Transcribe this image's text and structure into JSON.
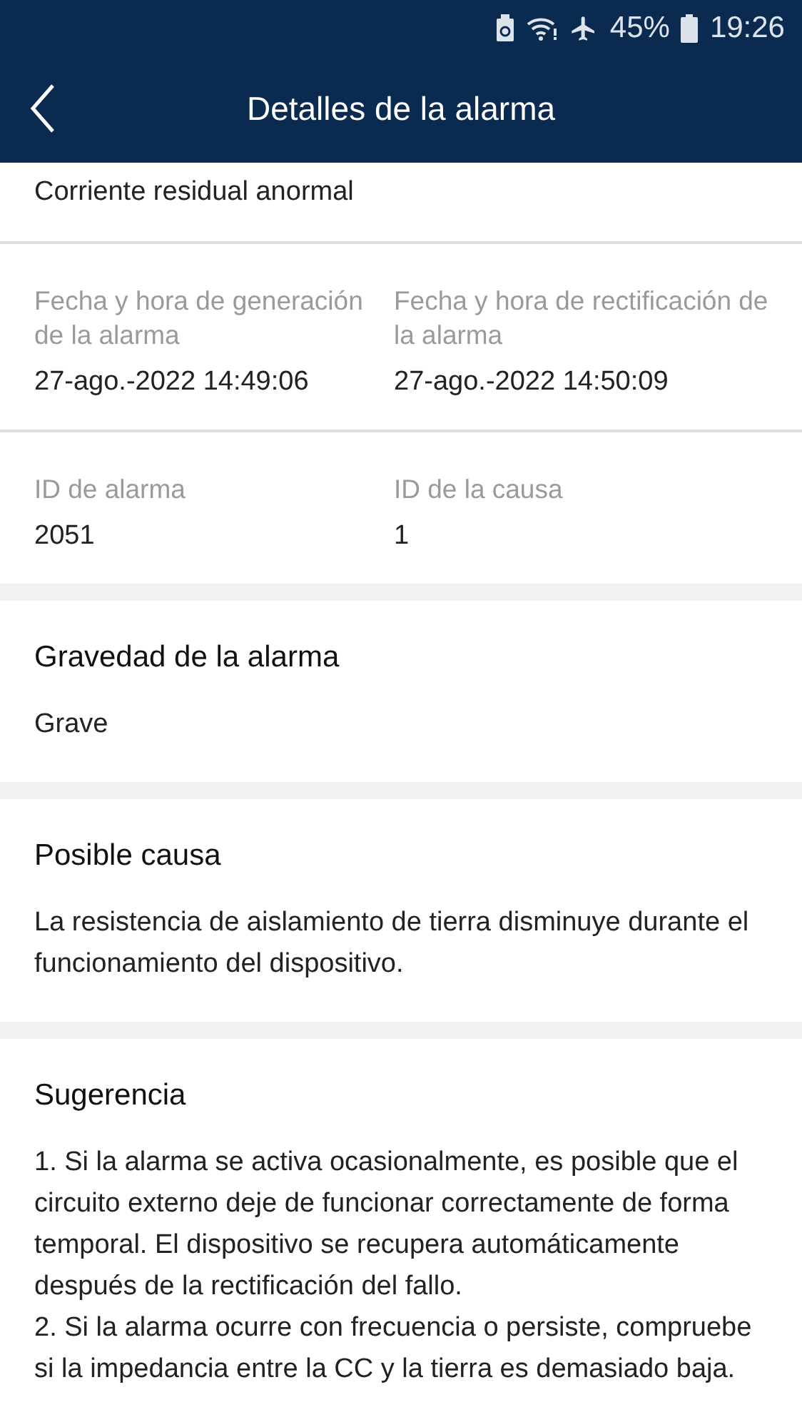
{
  "status_bar": {
    "battery_percent": "45%",
    "time": "19:26"
  },
  "header": {
    "title": "Detalles de la alarma"
  },
  "alarm_name": "Corriente residual anormal",
  "field_rows": [
    {
      "fields": [
        {
          "label": "Fecha y hora de generación de la alarma",
          "value": "27-ago.-2022 14:49:06"
        },
        {
          "label": "Fecha y hora de rectificación de la alarma",
          "value": "27-ago.-2022 14:50:09"
        }
      ]
    },
    {
      "fields": [
        {
          "label": "ID de alarma",
          "value": "2051"
        },
        {
          "label": "ID de la causa",
          "value": "1"
        }
      ]
    }
  ],
  "sections": [
    {
      "title": "Gravedad de la alarma",
      "paragraphs": [
        "Grave"
      ]
    },
    {
      "title": "Posible causa",
      "paragraphs": [
        "La resistencia de aislamiento de tierra disminuye durante el funcionamiento del dispositivo."
      ]
    },
    {
      "title": "Sugerencia",
      "paragraphs": [
        "1. Si la alarma se activa ocasionalmente, es posible que el circuito externo deje de funcionar correctamente de forma temporal. El dispositivo se recupera automáticamente después de la rectificación del fallo.",
        "2. Si la alarma ocurre con frecuencia o persiste, compruebe si la impedancia entre la CC y la tierra es demasiado baja."
      ]
    }
  ]
}
